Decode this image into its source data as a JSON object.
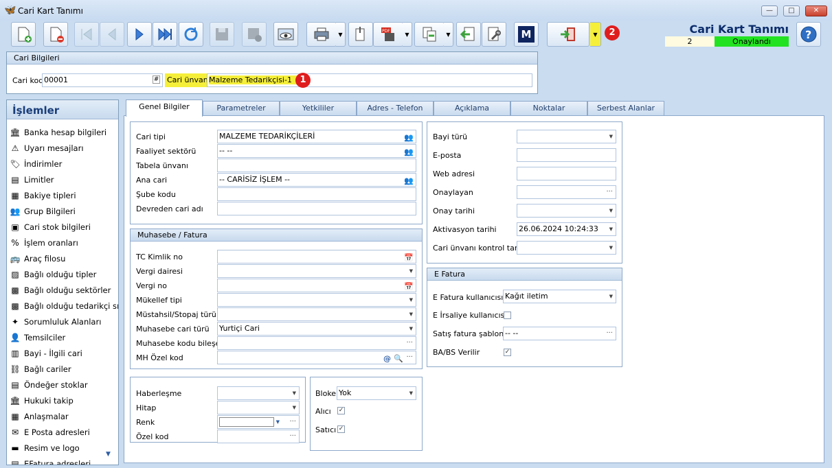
{
  "window": {
    "title": "Cari Kart Tanımı",
    "buttons": {
      "minimize": "—",
      "maximize": "□",
      "close": "✕"
    }
  },
  "header": {
    "form_title": "Cari Kart Tanımı",
    "record_no": "2",
    "status": "Onaylandı",
    "status_color": "#22e222",
    "marker1": "1",
    "marker2": "2",
    "m_button": "M"
  },
  "cari_bilgileri": {
    "title": "Cari Bilgileri",
    "kod_label": "Cari kod",
    "kod_value": "00001",
    "unvan_label": "Cari ünvanı",
    "unvan_value": "Malzeme Tedarikçisi-1"
  },
  "sidebar": {
    "title": "İşlemler",
    "items": [
      {
        "label": "Banka hesap bilgileri",
        "icon": "bank-icon"
      },
      {
        "label": "Uyarı mesajları",
        "icon": "warning-icon"
      },
      {
        "label": "İndirimler",
        "icon": "discount-icon"
      },
      {
        "label": "Limitler",
        "icon": "limit-icon"
      },
      {
        "label": "Bakiye tipleri",
        "icon": "balance-icon"
      },
      {
        "label": "Grup Bilgileri",
        "icon": "group-icon"
      },
      {
        "label": "Cari stok bilgileri",
        "icon": "stock-icon"
      },
      {
        "label": "İşlem oranları",
        "icon": "percent-icon"
      },
      {
        "label": "Araç filosu",
        "icon": "vehicle-icon"
      },
      {
        "label": "Bağlı olduğu tipler",
        "icon": "types-icon"
      },
      {
        "label": "Bağlı olduğu sektörler",
        "icon": "sectors-icon"
      },
      {
        "label": "Bağlı olduğu tedarikçi sı...",
        "icon": "supplier-icon"
      },
      {
        "label": "Sorumluluk Alanları",
        "icon": "responsibility-icon"
      },
      {
        "label": "Temsilciler",
        "icon": "person-icon"
      },
      {
        "label": "Bayi - İlgili cari",
        "icon": "dealer-icon"
      },
      {
        "label": "Bağlı cariler",
        "icon": "linked-icon"
      },
      {
        "label": "Öndeğer stoklar",
        "icon": "default-stock-icon"
      },
      {
        "label": "Hukuki takip",
        "icon": "legal-icon"
      },
      {
        "label": "Anlaşmalar",
        "icon": "agreement-icon"
      },
      {
        "label": "E Posta adresleri",
        "icon": "email-icon"
      },
      {
        "label": "Resim ve logo",
        "icon": "image-icon"
      },
      {
        "label": "EFatura adresleri",
        "icon": "einvoice-icon"
      }
    ]
  },
  "tabs": [
    "Genel Bilgiler",
    "Parametreler",
    "Yetkililer",
    "Adres - Telefon",
    "Açıklama",
    "Noktalar",
    "Serbest Alanlar"
  ],
  "genel": {
    "cari_tipi_label": "Cari tipi",
    "cari_tipi_value": "MALZEME TEDARİKÇİLERİ",
    "faaliyet_label": "Faaliyet sektörü",
    "faaliyet_value": "-- --",
    "tabela_label": "Tabela ünvanı",
    "ana_cari_label": "Ana cari",
    "ana_cari_value": "-- CARİSİZ İŞLEM --",
    "sube_label": "Şube kodu",
    "devreden_label": "Devreden cari adı"
  },
  "muhasebe": {
    "title": "Muhasebe / Fatura",
    "tc_label": "TC Kimlik no",
    "vd_label": "Vergi dairesi",
    "vno_label": "Vergi no",
    "mukellef_label": "Mükellef tipi",
    "mustahsil_label": "Müstahsil/Stopaj türü",
    "muh_cari_label": "Muhasebe cari türü",
    "muh_cari_value": "Yurtiçi Cari",
    "muh_kod_label": "Muhasebe kodu bileşeni",
    "mh_ozel_label": "MH Özel kod"
  },
  "misc": {
    "haberlesme_label": "Haberleşme",
    "hitap_label": "Hitap",
    "renk_label": "Renk",
    "ozel_kod_label": "Özel kod"
  },
  "bloke": {
    "bloke_label": "Bloke",
    "bloke_value": "Yok",
    "alici_label": "Alıcı",
    "alici_checked": true,
    "satici_label": "Satıcı",
    "satici_checked": true
  },
  "right": {
    "bayi_label": "Bayi türü",
    "eposta_label": "E-posta",
    "web_label": "Web adresi",
    "onaylayan_label": "Onaylayan",
    "onay_tarihi_label": "Onay tarihi",
    "aktivasyon_label": "Aktivasyon tarihi",
    "aktivasyon_value": "26.06.2024 10:24:33",
    "kontrol_label": "Cari ünvanı kontrol tarihi"
  },
  "efatura": {
    "title": "E Fatura",
    "kullanici_label": "E Fatura kullanıcısı",
    "kullanici_value": "Kağıt iletim",
    "irsaliye_label": "E İrsaliye kullanıcısı",
    "irsaliye_checked": false,
    "sablon_label": "Satış fatura şablonu",
    "sablon_value": "-- --",
    "babs_label": "BA/BS Verilir",
    "babs_checked": true
  },
  "glyphs": {
    "check": "✓",
    "dd": "▼",
    "dots": "...",
    "hash": "#"
  }
}
